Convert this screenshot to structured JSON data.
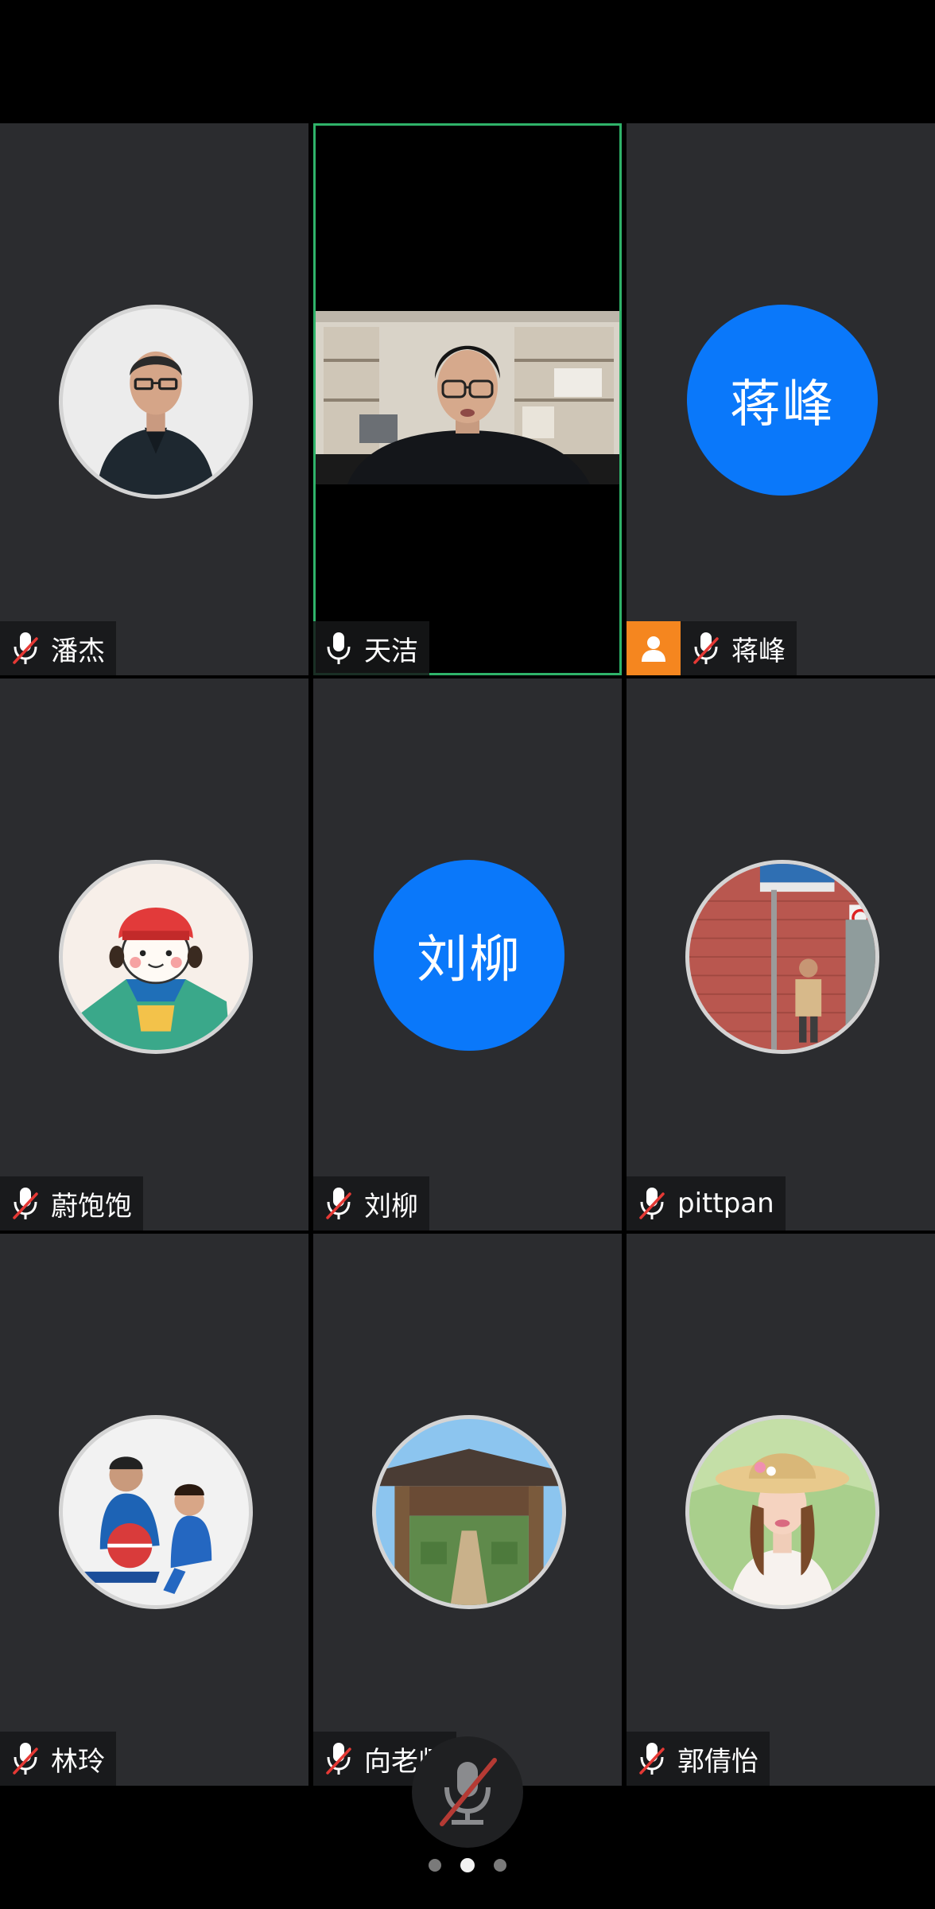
{
  "participants": [
    {
      "name": "潘杰",
      "muted": true,
      "type": "photo",
      "avatar": "man-portrait"
    },
    {
      "name": "天洁",
      "muted": false,
      "type": "video",
      "active_speaker": true
    },
    {
      "name": "蒋峰",
      "muted": true,
      "type": "initials",
      "initials": "蒋峰",
      "host": true
    },
    {
      "name": "蔚饱饱",
      "muted": true,
      "type": "photo",
      "avatar": "cartoon-girl"
    },
    {
      "name": "刘柳",
      "muted": true,
      "type": "initials",
      "initials": "刘柳"
    },
    {
      "name": "pittpan",
      "muted": true,
      "type": "photo",
      "avatar": "street-man"
    },
    {
      "name": "林玲",
      "muted": true,
      "type": "photo",
      "avatar": "two-kids"
    },
    {
      "name": "向老师",
      "muted": true,
      "type": "photo",
      "avatar": "gate"
    },
    {
      "name": "郭倩怡",
      "muted": true,
      "type": "photo",
      "avatar": "woman-hat"
    }
  ],
  "pagination": {
    "pages": 3,
    "current": 2
  },
  "colors": {
    "tile_bg": "#2b2c2f",
    "active_border": "#2fb36a",
    "initials_bg": "#0a78fa",
    "host_badge": "#f5861f",
    "muted_slash": "#e53935"
  },
  "icons": {
    "mic": "mic-icon",
    "mic_muted": "mic-muted-icon",
    "host": "person-icon"
  }
}
